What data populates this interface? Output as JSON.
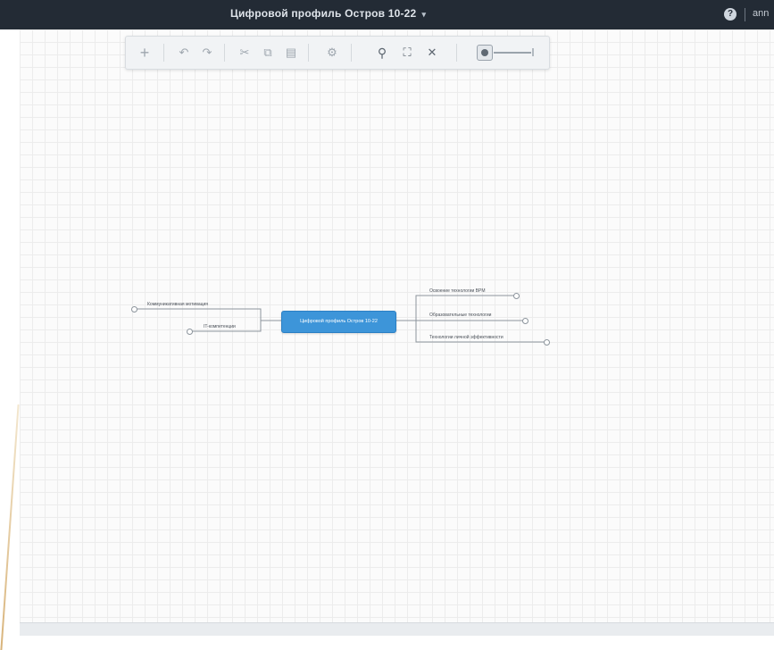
{
  "header": {
    "document_title": "Цифровой профиль Остров 10-22",
    "title_caret": "▾",
    "help_icon": "help-circle-icon",
    "user_name": "ann"
  },
  "toolbar": {
    "icons": [
      "plus-icon",
      "undo-icon",
      "redo-icon",
      "cut-icon",
      "copy-icon",
      "paste-icon",
      "settings-icon",
      "zoom-icon",
      "fit-to-screen-icon",
      "shrink-icon",
      "zoom-slider"
    ]
  },
  "mindmap": {
    "central_topic": "Цифровой профиль Остров 10-22",
    "left_branches": [
      {
        "label": "Коммуникативная мотивация"
      },
      {
        "label": "IT-компетенции"
      }
    ],
    "right_branches": [
      {
        "label": "Освоение технологии BPM"
      },
      {
        "label": "Образовательные технологии"
      },
      {
        "label": "Технологии личной эффективности"
      }
    ],
    "colors": {
      "central_fill": "#3d95d9",
      "link": "#8c949c"
    }
  }
}
